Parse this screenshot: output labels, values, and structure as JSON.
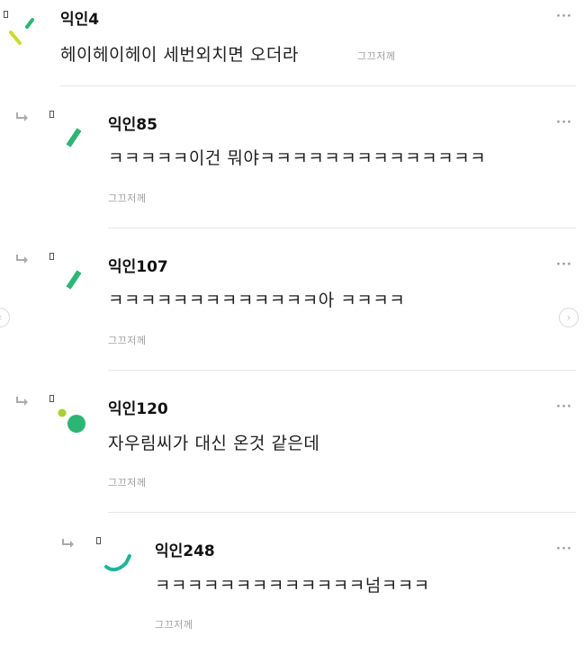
{
  "comments": [
    {
      "author": "익인4",
      "text": "헤이헤이헤이 세번외치면 오더라",
      "reaction": "그끄저께",
      "more": "···"
    },
    {
      "author": "익인85",
      "text": "ㅋㅋㅋㅋㅋ이건 뭐야ㅋㅋㅋㅋㅋㅋㅋㅋㅋㅋㅋㅋㅋㅋ",
      "reaction": "그끄저께",
      "more": "···"
    },
    {
      "author": "익인107",
      "text": "ㅋㅋㅋㅋㅋㅋㅋㅋㅋㅋㅋㅋㅋ아 ㅋㅋㅋㅋ",
      "reaction": "그끄저께",
      "more": "···"
    },
    {
      "author": "익인120",
      "text": "자우림씨가 대신 온것 같은데",
      "reaction": "그끄저께",
      "more": "···"
    },
    {
      "author": "익인248",
      "text": "ㅋㅋㅋㅋㅋㅋㅋㅋㅋㅋㅋㅋㅋ넘ㅋㅋㅋ",
      "reaction": "그끄저께",
      "more": "···"
    }
  ],
  "nav": {
    "prev": "‹",
    "next": "›"
  },
  "colors": {
    "green": "#2bb673",
    "lime": "#a6d12e",
    "teal": "#1fb39a"
  }
}
